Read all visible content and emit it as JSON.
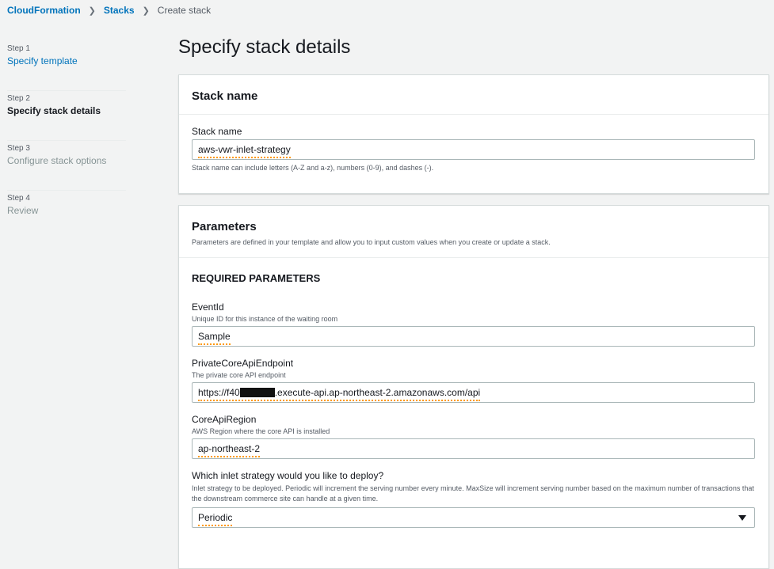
{
  "breadcrumb": {
    "items": [
      "CloudFormation",
      "Stacks"
    ],
    "current": "Create stack"
  },
  "steps": [
    {
      "num": "Step 1",
      "title": "Specify template"
    },
    {
      "num": "Step 2",
      "title": "Specify stack details"
    },
    {
      "num": "Step 3",
      "title": "Configure stack options"
    },
    {
      "num": "Step 4",
      "title": "Review"
    }
  ],
  "page_title": "Specify stack details",
  "stack_name_panel": {
    "title": "Stack name",
    "field_label": "Stack name",
    "value": "aws-vwr-inlet-strategy",
    "hint": "Stack name can include letters (A-Z and a-z), numbers (0-9), and dashes (-)."
  },
  "parameters_panel": {
    "title": "Parameters",
    "description": "Parameters are defined in your template and allow you to input custom values when you create or update a stack.",
    "section_title": "REQUIRED PARAMETERS",
    "params": [
      {
        "label": "EventId",
        "desc": "Unique ID for this instance of the waiting room",
        "value": "Sample"
      },
      {
        "label": "PrivateCoreApiEndpoint",
        "desc": "The private core API endpoint",
        "value_prefix": "https://f40",
        "value_suffix": ".execute-api.ap-northeast-2.amazonaws.com/api"
      },
      {
        "label": "CoreApiRegion",
        "desc": "AWS Region where the core API is installed",
        "value": "ap-northeast-2"
      },
      {
        "label": "Which inlet strategy would you like to deploy?",
        "desc": "Inlet strategy to be deployed. Periodic will increment the serving number every minute. MaxSize will increment serving number based on the maximum number of transactions that the downstream commerce site can handle at a given time.",
        "value": "Periodic"
      }
    ]
  }
}
